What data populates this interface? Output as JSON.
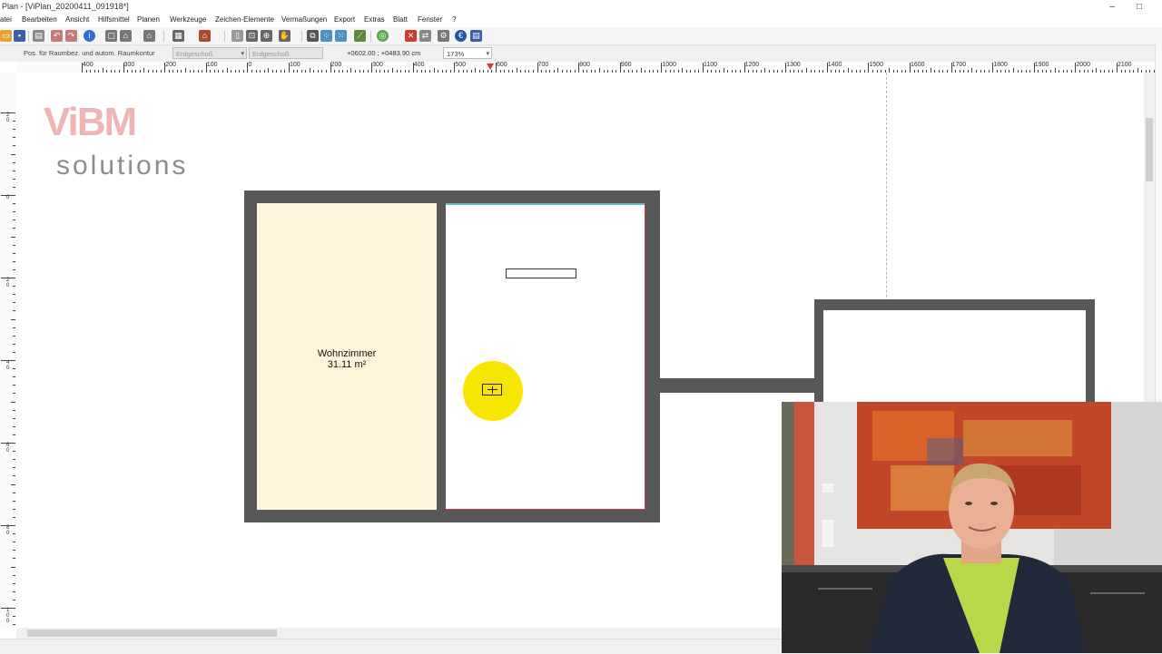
{
  "window": {
    "title": "Plan - [ViPlan_20200411_091918*]",
    "controls": [
      "–",
      "□"
    ]
  },
  "menu": [
    "atei",
    "Bearbeiten",
    "Ansicht",
    "Hilfsmittel",
    "Planen",
    "Werkzeuge",
    "Zeichen-Elemente",
    "Vermaßungen",
    "Export",
    "Extras",
    "Blatt",
    "Fenster",
    "?"
  ],
  "status": {
    "mode_label": "Pos. für Raumbez. und autom. Raumkontur",
    "floor_select": "Erdgeschoß",
    "floor_select_2": "Erdgeschoß",
    "coordinates": "+0602.00 ; +0483.90 cm",
    "zoom": "173%"
  },
  "ruler_h_labels": [
    "400",
    "300",
    "200",
    "100",
    "0",
    "100",
    "200",
    "300",
    "400",
    "500",
    "600",
    "700",
    "800",
    "900",
    "1000",
    "1100",
    "1200",
    "1300",
    "1400",
    "1500",
    "1600",
    "1700",
    "1800",
    "1900",
    "2000",
    "2100"
  ],
  "ruler_v_labels": [
    "20",
    "0",
    "20",
    "40",
    "60",
    "80",
    "100"
  ],
  "room": {
    "name": "Wohnzimmer",
    "area": "31.11 m²"
  },
  "logo": {
    "mark": "ViBM",
    "text": "solutions"
  },
  "colors": {
    "wall": "#585858",
    "room_fill": "#fff3d9",
    "cursor_highlight": "#f7e600",
    "accent_red": "#d0394b"
  },
  "icons": {
    "cursor": "crosshair-cursor-icon"
  }
}
